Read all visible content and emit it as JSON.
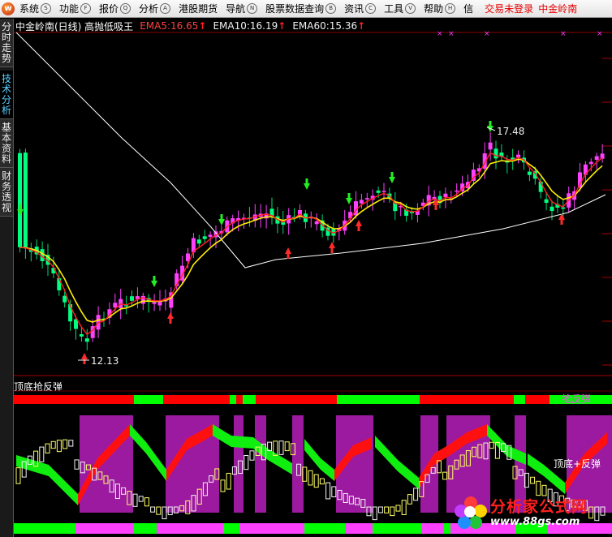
{
  "menu": {
    "logo": "w",
    "items": [
      {
        "label": "系统",
        "key": "S"
      },
      {
        "label": "功能",
        "key": "F"
      },
      {
        "label": "报价",
        "key": "Q"
      },
      {
        "label": "分析",
        "key": "A"
      },
      {
        "label": "港股期货",
        "key": ""
      },
      {
        "label": "导航",
        "key": "N"
      },
      {
        "label": "股票数据查询",
        "key": "B"
      },
      {
        "label": "资讯",
        "key": "C"
      },
      {
        "label": "工具",
        "key": "V"
      },
      {
        "label": "帮助",
        "key": "H"
      },
      {
        "label": "信",
        "key": ""
      }
    ],
    "login_status": "交易未登录",
    "stock": "中金岭南"
  },
  "side_tabs": [
    {
      "label": "分时走势",
      "active": false
    },
    {
      "label": "技术分析",
      "active": true
    },
    {
      "label": "基本资料",
      "active": false
    },
    {
      "label": "财务透视",
      "active": false
    }
  ],
  "main_header": {
    "stock_name": "中金岭南(日线) 高抛低吸王",
    "ema5": "EMA5:16.65",
    "ema10": "EMA10:16.19",
    "ema60": "EMA60:15.36",
    "arrow": "↑"
  },
  "annotations": {
    "high_label": "17.48",
    "low_label": "12.13",
    "sub_label_top": "抢反弹",
    "sub_label_mid": "顶底+反弹"
  },
  "sub_header": {
    "title": "顶底抢反弹"
  },
  "watermark": {
    "title": "分析家公式网",
    "url": "www.88gs.com"
  },
  "colors": {
    "up": "#ff40ff",
    "down": "#00ff80",
    "ema5": "#ff2020",
    "ema10": "#ffff00",
    "ema60": "#ffffff",
    "zone": "#9c1aa0",
    "bar_red": "#ff0000",
    "bar_green": "#00ff00"
  }
}
